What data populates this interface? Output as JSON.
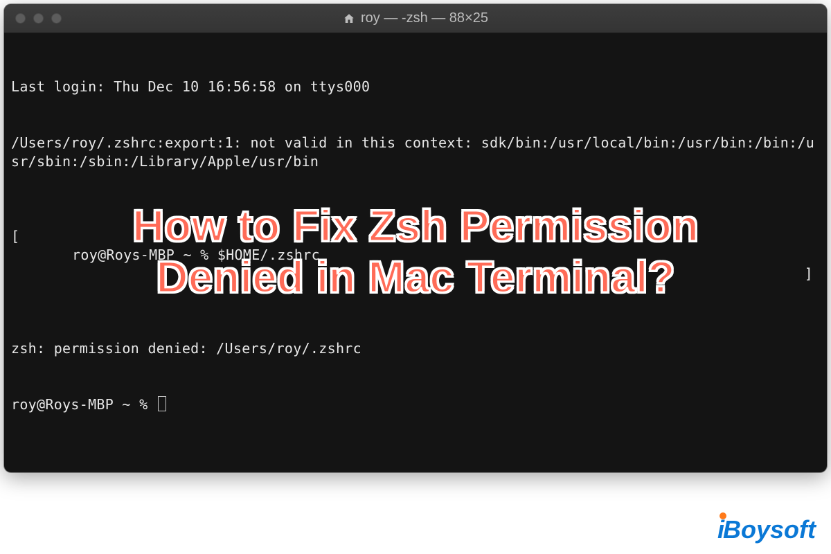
{
  "window": {
    "title": "roy — -zsh — 88×25"
  },
  "terminal": {
    "lines": [
      "Last login: Thu Dec 10 16:56:58 on ttys000",
      "/Users/roy/.zshrc:export:1: not valid in this context: sdk/bin:/usr/local/bin:/usr/bin:/bin:/usr/sbin:/sbin:/Library/Apple/usr/bin"
    ],
    "prompt1_open": "[",
    "prompt1_inner": "roy@Roys-MBP ~ % $HOME/.zshrc",
    "prompt1_close": "]",
    "error_line": "zsh: permission denied: /Users/roy/.zshrc",
    "prompt2": "roy@Roys-MBP ~ % "
  },
  "overlay": {
    "line1": "How to Fix Zsh Permission",
    "line2": "Denied in Mac Terminal?"
  },
  "watermark": {
    "text": "iBoysoft"
  }
}
